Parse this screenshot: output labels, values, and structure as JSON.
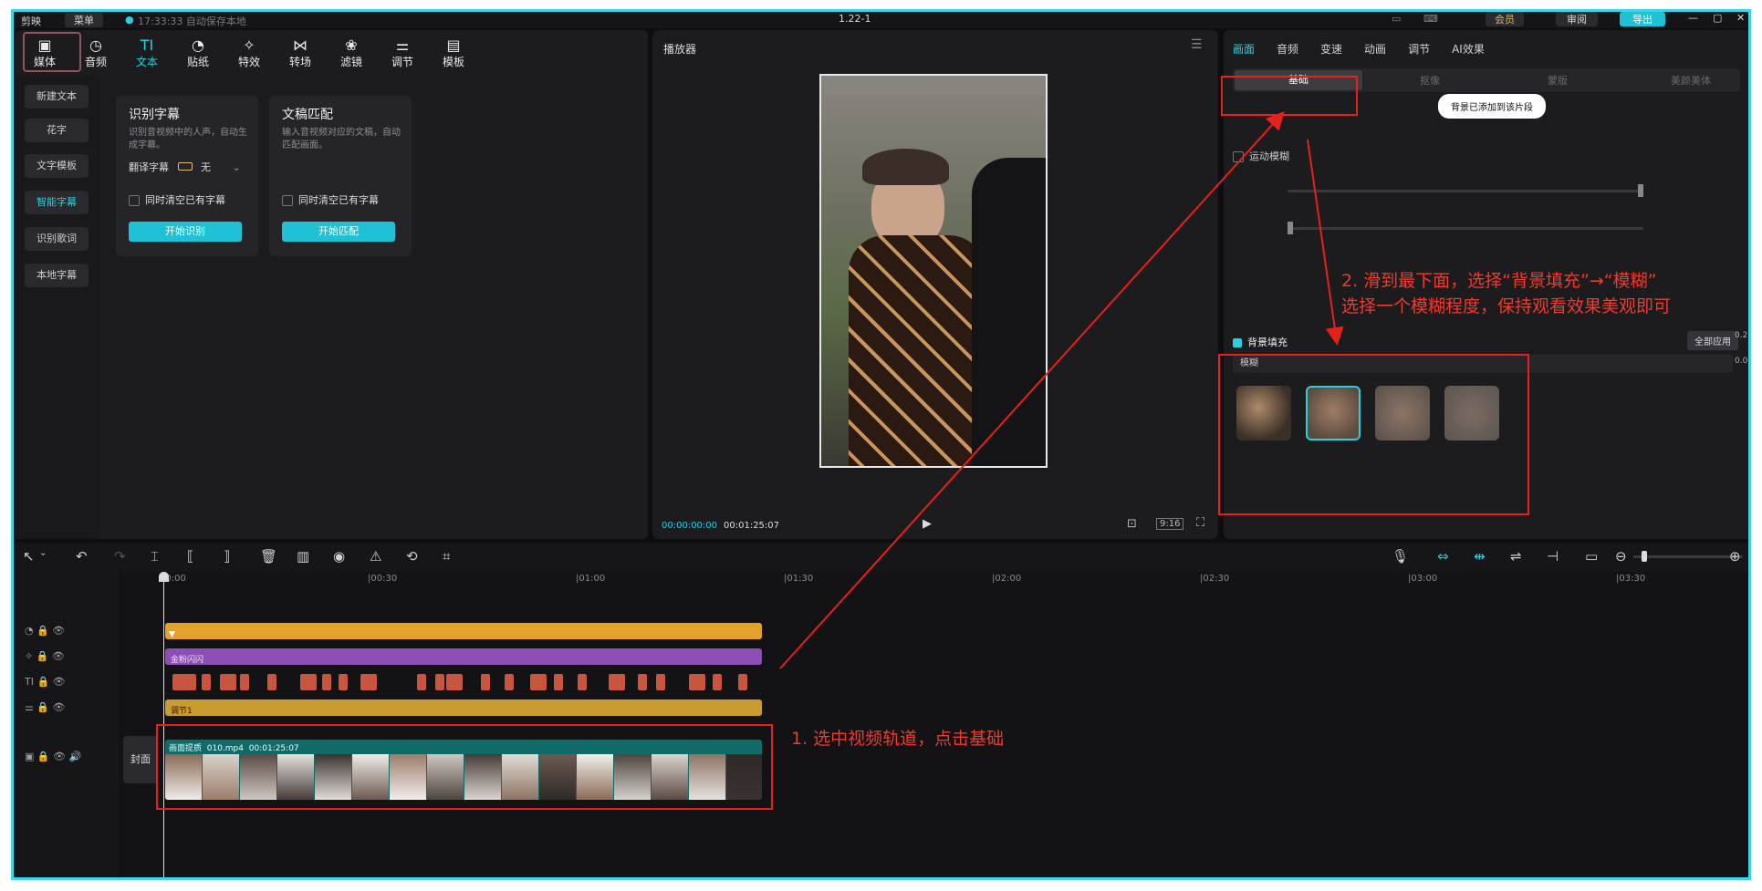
{
  "window": {
    "app_name": "剪映",
    "menu_label": "菜单",
    "autosave_text": "17:33:33 自动保存本地",
    "project_title": "1.22-1",
    "account_label": "会员",
    "review_label": "审阅",
    "export_label": "导出"
  },
  "toolbar_tabs": [
    {
      "label": "媒体",
      "icon": "media-icon"
    },
    {
      "label": "音频",
      "icon": "audio-icon"
    },
    {
      "label": "文本",
      "icon": "text-icon"
    },
    {
      "label": "贴纸",
      "icon": "sticker-icon"
    },
    {
      "label": "特效",
      "icon": "effects-icon"
    },
    {
      "label": "转场",
      "icon": "transition-icon"
    },
    {
      "label": "滤镜",
      "icon": "filter-icon"
    },
    {
      "label": "调节",
      "icon": "adjust-icon"
    },
    {
      "label": "模板",
      "icon": "template-icon"
    }
  ],
  "sidebar": {
    "items": [
      {
        "label": "新建文本"
      },
      {
        "label": "花字"
      },
      {
        "label": "文字模板"
      },
      {
        "label": "智能字幕"
      },
      {
        "label": "识别歌词"
      },
      {
        "label": "本地字幕"
      }
    ]
  },
  "cards": {
    "recognize": {
      "title": "识别字幕",
      "desc": "识别音视频中的人声，自动生成字幕。",
      "translate_label": "翻译字幕",
      "translate_value": "无",
      "clear_label": "同时清空已有字幕",
      "button": "开始识别"
    },
    "match": {
      "title": "文稿匹配",
      "desc": "输入音视频对应的文稿，自动匹配画面。",
      "clear_label": "同时清空已有字幕",
      "button": "开始匹配"
    }
  },
  "player": {
    "title": "播放器",
    "current_time": "00:00:00:00",
    "total_time": "00:01:25:07",
    "ratio": "9:16"
  },
  "right_panel": {
    "tabs": [
      "画面",
      "音频",
      "变速",
      "动画",
      "调节",
      "AI效果"
    ],
    "subtabs": [
      "基础",
      "抠像",
      "蒙版",
      "美颜美体"
    ],
    "tooltip": "背景已添加到该片段",
    "motion_blur_label": "运动模糊",
    "bg_fill_label": "背景填充",
    "apply_all_label": "全部应用",
    "blur_dropdown": "模糊",
    "blur_options": [
      {
        "name": "blur-preset-1"
      },
      {
        "name": "blur-preset-2",
        "selected": true
      },
      {
        "name": "blur-preset-3"
      },
      {
        "name": "blur-preset-4"
      }
    ],
    "side_values": [
      "0.2",
      "0.0"
    ]
  },
  "timeline": {
    "ticks": [
      "00:00",
      "|00:30",
      "|01:00",
      "|01:30",
      "|02:00",
      "|02:30",
      "|03:00",
      "|03:30"
    ],
    "tracks": [
      {
        "name": "effect-track",
        "color": "#e4a22b",
        "label": ""
      },
      {
        "name": "sticker-track",
        "color": "#8e4fb5",
        "label": "金粉闪闪"
      },
      {
        "name": "text-track",
        "color": "#c8553f",
        "label": ""
      },
      {
        "name": "adjust-track",
        "color": "#c99b30",
        "label": "调节1"
      }
    ],
    "cover_label": "封面",
    "video_clip": {
      "label_prefix": "画面提质",
      "file": "010.mp4",
      "duration": "00:01:25:07"
    }
  },
  "annotations": {
    "step1": "1. 选中视频轨道，点击基础",
    "step2_line1": "2. 滑到最下面，选择“背景填充”→“模糊”",
    "step2_line2": "选择一个模糊程度，保持观看效果美观即可"
  },
  "colors": {
    "accent": "#1fc2d4",
    "annotation_red": "#e8201a",
    "frame_border": "#3dd6e8"
  }
}
